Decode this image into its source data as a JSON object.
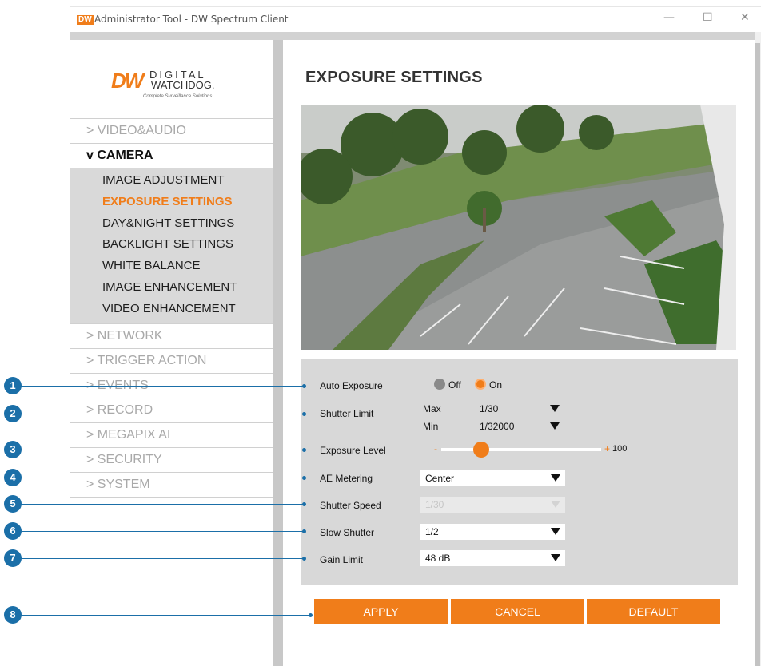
{
  "window": {
    "app_icon": "DW",
    "title": "Administrator Tool - DW Spectrum Client",
    "minimize": "—",
    "maximize": "☐",
    "close": "✕"
  },
  "logo": {
    "mark": "DW",
    "line1": "DIGITAL",
    "line2": "WATCHDOG.",
    "tagline": "Complete Surveillance Solutions"
  },
  "sidebar": {
    "items_before": [
      "> VIDEO&AUDIO"
    ],
    "open_item": "v CAMERA",
    "sub_items": [
      "IMAGE ADJUSTMENT",
      "EXPOSURE SETTINGS",
      "DAY&NIGHT SETTINGS",
      "BACKLIGHT SETTINGS",
      "WHITE BALANCE",
      "IMAGE ENHANCEMENT",
      "VIDEO ENHANCEMENT"
    ],
    "active_sub_index": 1,
    "items_after": [
      "> NETWORK",
      "> TRIGGER ACTION",
      "> EVENTS",
      "> RECORD",
      "> MEGAPIX AI",
      "> SECURITY",
      "> SYSTEM"
    ]
  },
  "main": {
    "title": "EXPOSURE SETTINGS",
    "auto_exposure": {
      "label": "Auto Exposure",
      "off": "Off",
      "on": "On",
      "selected": "On"
    },
    "shutter_limit": {
      "label": "Shutter Limit",
      "max_label": "Max",
      "max_value": "1/30",
      "min_label": "Min",
      "min_value": "1/32000"
    },
    "exposure_level": {
      "label": "Exposure Level",
      "minus": "-",
      "plus": "+",
      "value": "100",
      "position_fraction": 0.25
    },
    "ae_metering": {
      "label": "AE Metering",
      "value": "Center"
    },
    "shutter_speed": {
      "label": "Shutter Speed",
      "value": "1/30",
      "disabled": true
    },
    "slow_shutter": {
      "label": "Slow Shutter",
      "value": "1/2"
    },
    "gain_limit": {
      "label": "Gain Limit",
      "value": "48 dB"
    },
    "buttons": {
      "apply": "APPLY",
      "cancel": "CANCEL",
      "default": "DEFAULT"
    }
  },
  "callouts": [
    "1",
    "2",
    "3",
    "4",
    "5",
    "6",
    "7",
    "8"
  ],
  "colors": {
    "accent": "#f07d1a",
    "callout": "#1b6fa8",
    "panel": "#d8d8d8"
  }
}
